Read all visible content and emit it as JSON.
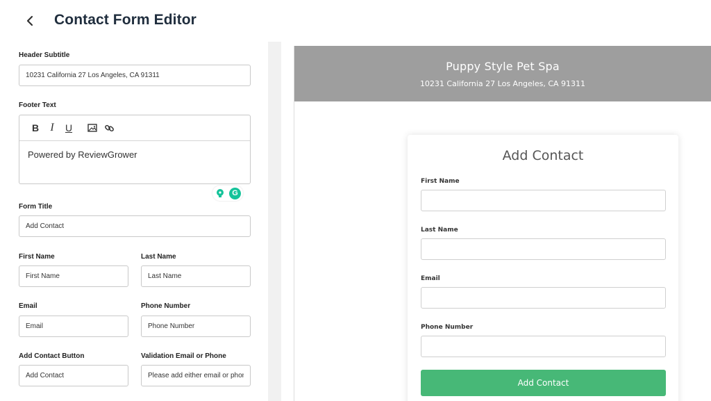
{
  "page": {
    "title": "Contact Form Editor"
  },
  "editor": {
    "header_subtitle": {
      "label": "Header Subtitle",
      "value": "10231 California 27 Los Angeles, CA 91311"
    },
    "footer_text": {
      "label": "Footer Text",
      "toolbar": [
        "bold",
        "italic",
        "underline",
        "image",
        "link"
      ],
      "toolbar_labels": {
        "bold": "B",
        "italic": "I",
        "underline": "U"
      },
      "value": "Powered by ReviewGrower"
    },
    "form_title": {
      "label": "Form Title",
      "value": "Add Contact"
    },
    "first_name": {
      "label": "First Name",
      "value": "First Name"
    },
    "last_name": {
      "label": "Last Name",
      "value": "Last Name"
    },
    "email": {
      "label": "Email",
      "value": "Email"
    },
    "phone_number": {
      "label": "Phone Number",
      "value": "Phone Number"
    },
    "add_contact_button": {
      "label": "Add Contact Button",
      "value": "Add Contact"
    },
    "validation": {
      "label": "Validation Email or Phone",
      "value": "Please add either email or phone"
    },
    "grammarly_logo": "G"
  },
  "preview": {
    "header_title": "Puppy Style Pet Spa",
    "header_subtitle": "10231 California 27 Los Angeles, CA 91311",
    "form_title": "Add Contact",
    "fields": [
      {
        "label": "First Name"
      },
      {
        "label": "Last Name"
      },
      {
        "label": "Email"
      },
      {
        "label": "Phone Number"
      }
    ],
    "button_label": "Add Contact"
  },
  "colors": {
    "preview_header_bg": "#9e9e9e",
    "button_green": "#47b877",
    "title_color": "#1f2d3d",
    "grammarly_green": "#15c39a"
  },
  "icons": [
    "chevron-left-icon",
    "image-icon",
    "link-icon",
    "lightbulb-icon",
    "grammarly-icon"
  ]
}
